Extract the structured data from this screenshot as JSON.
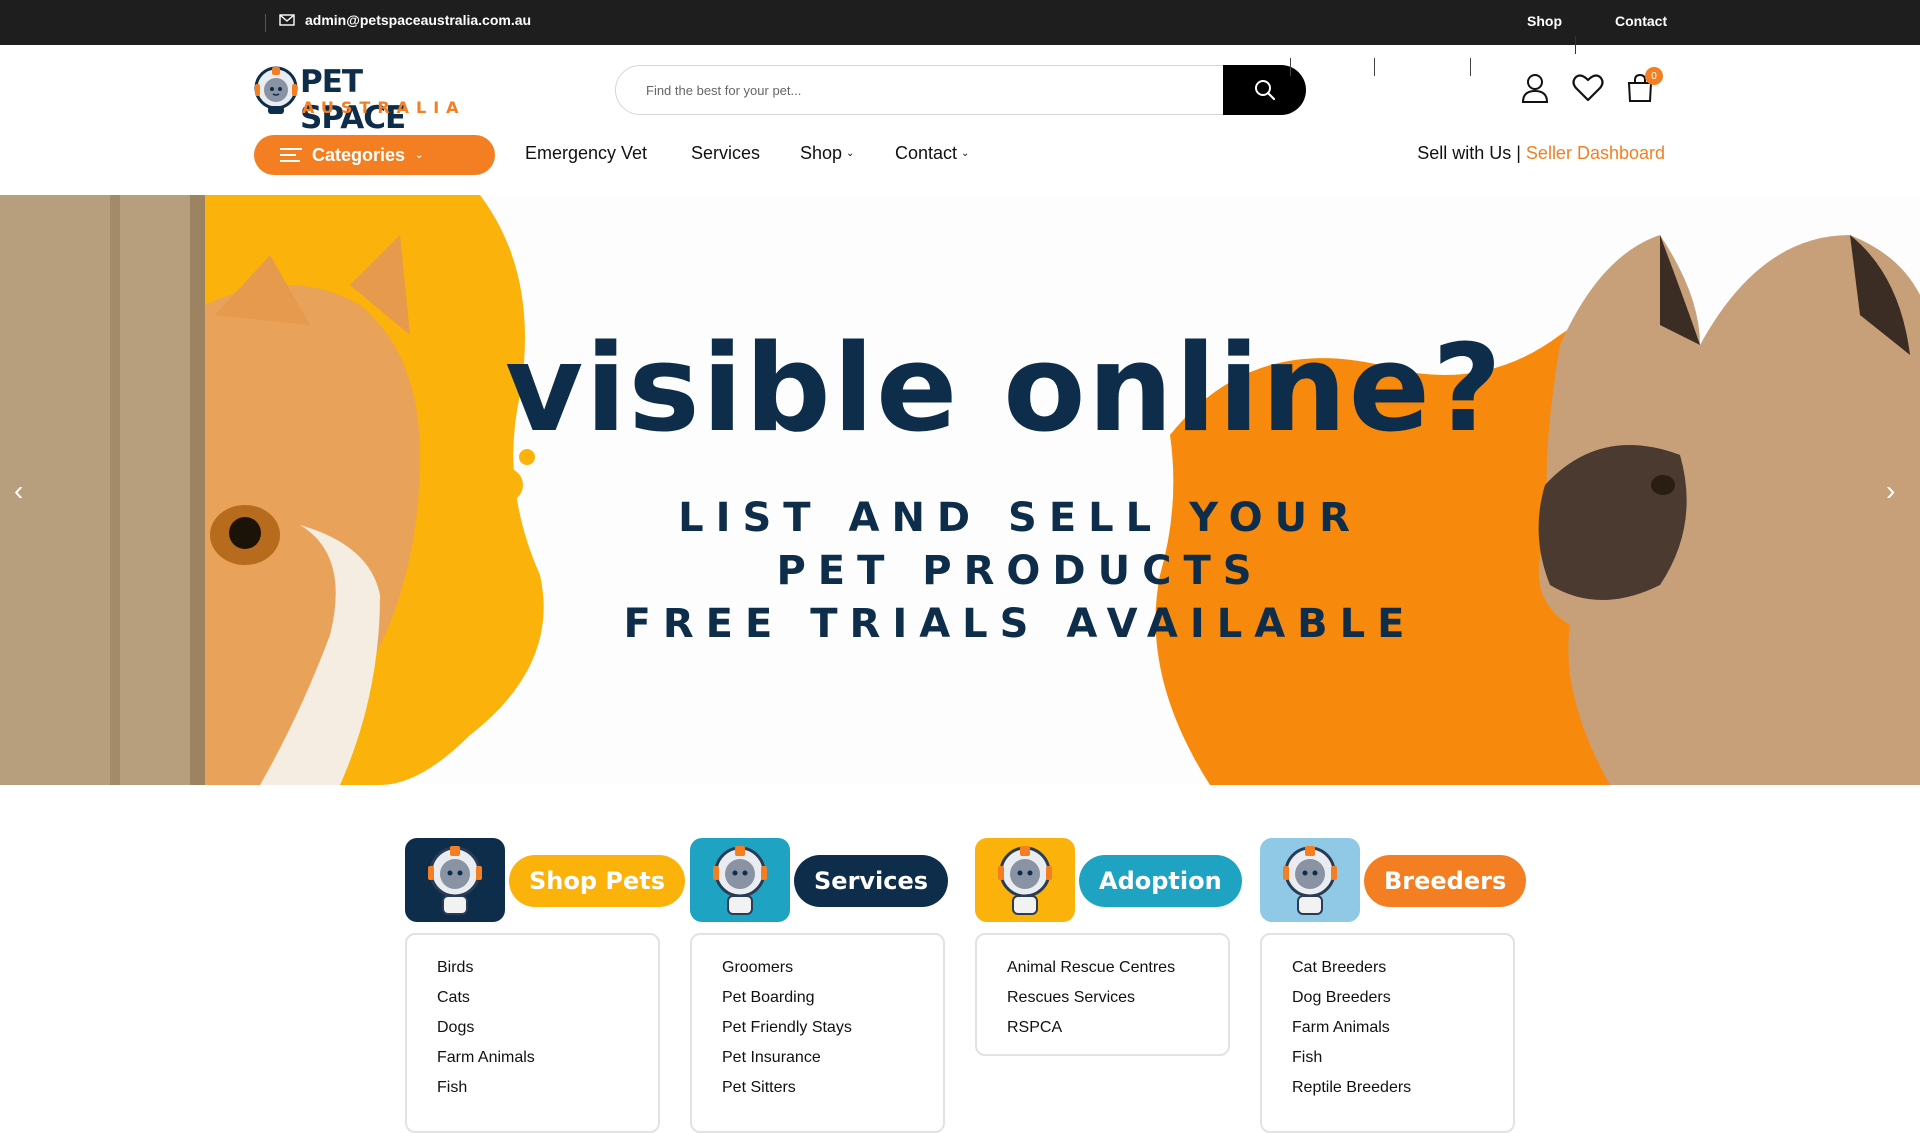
{
  "topbar": {
    "email": "admin@petspaceaustralia.com.au",
    "links": [
      "Shop",
      "Contact"
    ]
  },
  "logo": {
    "line1": "PET SPACE",
    "line2": "AUSTRALIA"
  },
  "search": {
    "placeholder": "Find the best for your pet...",
    "value": ""
  },
  "cart": {
    "count": "0"
  },
  "nav": {
    "categories_label": "Categories",
    "items": [
      "Emergency Vet",
      "Services",
      "Shop",
      "Contact"
    ],
    "sell_label": "Sell with Us |",
    "seller_dashboard": "Seller Dashboard"
  },
  "hero": {
    "headline": "visible online?",
    "line1": "LIST AND SELL YOUR",
    "line2": "PET PRODUCTS",
    "line3": "FREE TRIALS AVAILABLE"
  },
  "cards": [
    {
      "title": "Shop Pets",
      "pill_color": "#fbb20a",
      "icon_bg": "#0d2d4a",
      "items": [
        "Birds",
        "Cats",
        "Dogs",
        "Farm Animals",
        "Fish"
      ]
    },
    {
      "title": "Services",
      "pill_color": "#0d2d4a",
      "icon_bg": "#1fa3c2",
      "items": [
        "Groomers",
        "Pet Boarding",
        "Pet Friendly Stays",
        "Pet Insurance",
        "Pet Sitters"
      ]
    },
    {
      "title": "Adoption",
      "pill_color": "#1fa3c2",
      "icon_bg": "#fbb20a",
      "items": [
        "Animal Rescue Centres",
        "Rescues Services",
        "RSPCA"
      ]
    },
    {
      "title": "Breeders",
      "pill_color": "#f37f22",
      "icon_bg": "#8fc9e6",
      "items": [
        "Cat Breeders",
        "Dog Breeders",
        "Farm Animals",
        "Fish",
        "Reptile Breeders"
      ]
    }
  ],
  "colors": {
    "accent": "#f37f22",
    "navy": "#0d2d4a",
    "yellow": "#fbb20a",
    "teal": "#1fa3c2"
  }
}
